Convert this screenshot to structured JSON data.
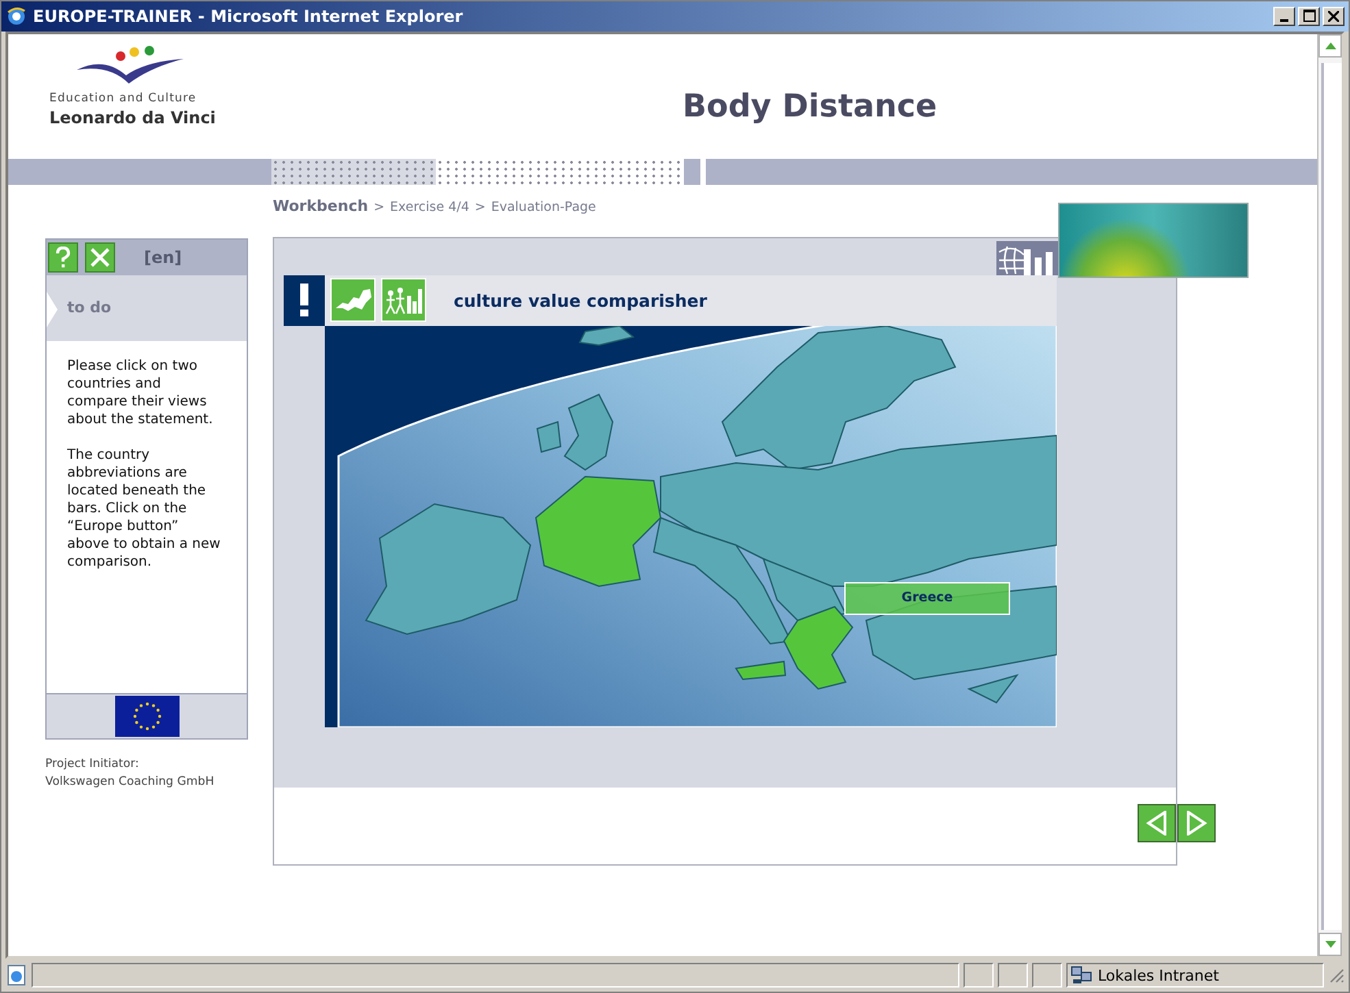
{
  "window": {
    "title": "EUROPE-TRAINER - Microsoft Internet Explorer"
  },
  "header": {
    "logo_caption": "Education and Culture",
    "logo_title": "Leonardo da Vinci",
    "page_title": "Body Distance"
  },
  "breadcrumb": {
    "items": [
      "Workbench",
      "Exercise 4/4",
      "Evaluation-Page"
    ],
    "separator": ">"
  },
  "sidebar": {
    "language": "[en]",
    "section": "to do",
    "paragraphs": [
      "Please click on two countries and compare their views about the statement.",
      "The country abbreviations are located beneath the bars. Click on the “Europe button” above to obtain a new comparison."
    ],
    "footer_lines": [
      "Project Initiator:",
      "Volkswagen Coaching GmbH"
    ]
  },
  "exercise": {
    "title": "culture value comparisher",
    "map_label": "Greece"
  },
  "status_bar": {
    "zone": "Lokales Intranet"
  }
}
